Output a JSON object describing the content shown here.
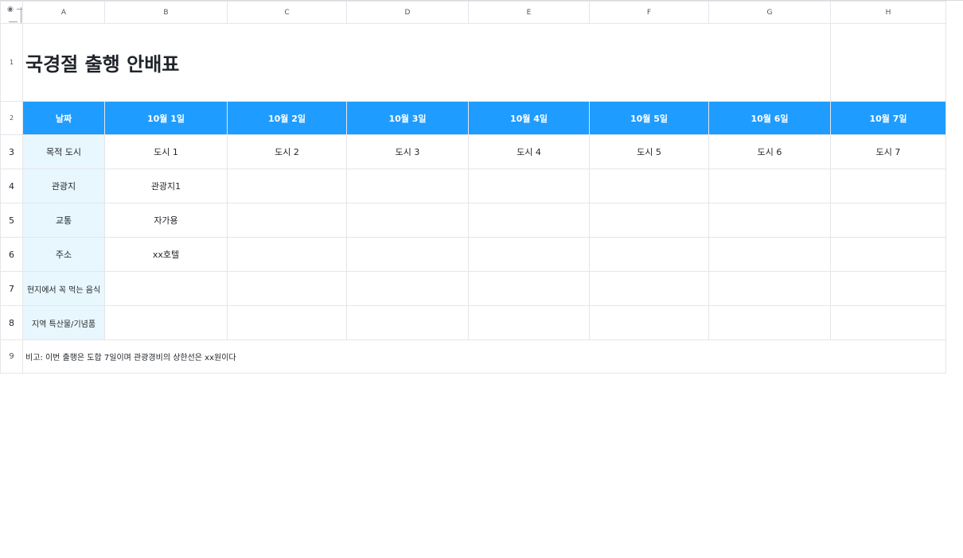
{
  "columns": [
    "A",
    "B",
    "C",
    "D",
    "E",
    "F",
    "G",
    "H"
  ],
  "rows": [
    "1",
    "2",
    "3",
    "4",
    "5",
    "6",
    "7",
    "8",
    "9"
  ],
  "title": "국경절 출행 안배표",
  "header": {
    "label": "날짜",
    "dates": [
      "10월 1일",
      "10월 2일",
      "10월 3일",
      "10월 4일",
      "10월 5일",
      "10월 6일",
      "10월 7일"
    ]
  },
  "data_rows": [
    {
      "label": "목적 도시",
      "cells": [
        "도시 1",
        "도시 2",
        "도시 3",
        "도시 4",
        "도시 5",
        "도시 6",
        "도시 7"
      ]
    },
    {
      "label": "관광지",
      "cells": [
        "관광지1",
        "",
        "",
        "",
        "",
        "",
        ""
      ]
    },
    {
      "label": "교통",
      "cells": [
        "자가용",
        "",
        "",
        "",
        "",
        "",
        ""
      ]
    },
    {
      "label": "주소",
      "cells": [
        "xx호텔",
        "",
        "",
        "",
        "",
        "",
        ""
      ]
    },
    {
      "label": "현지에서 꼭 먹는 음식",
      "cells": [
        "",
        "",
        "",
        "",
        "",
        "",
        ""
      ]
    },
    {
      "label": "지역 특산물/기념품",
      "cells": [
        "",
        "",
        "",
        "",
        "",
        "",
        ""
      ]
    }
  ],
  "note": "비고: 이번 출행은 도합 7일이며 관광경비의 상한선은 xx원이다",
  "icons": {
    "view": "eye-icon",
    "freeze": "freeze-panes-icon"
  },
  "colors": {
    "header_bg": "#1f9cff",
    "header_text": "#ffffff",
    "label_bg": "#e8f7fd",
    "grid": "#e4e6ea"
  }
}
